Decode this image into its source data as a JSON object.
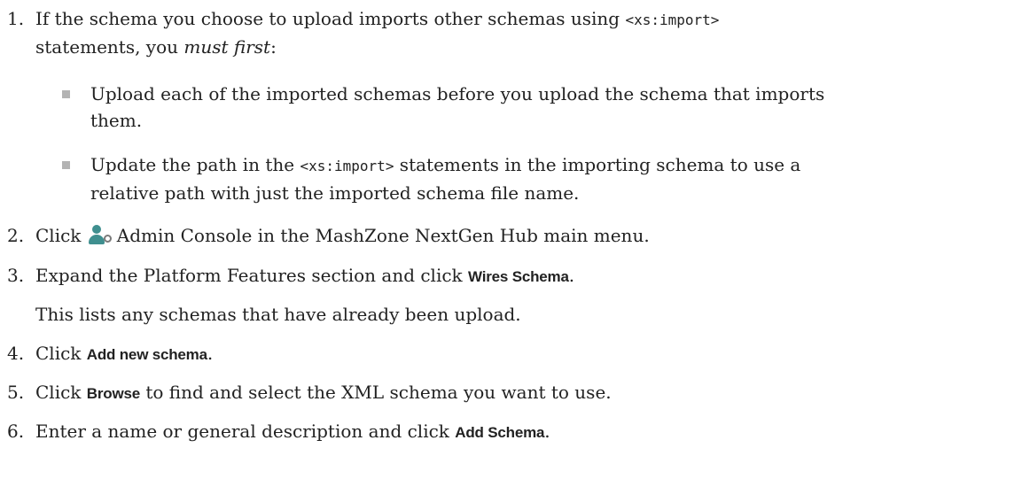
{
  "steps": [
    {
      "num": "1.",
      "before": "If the schema you choose to upload imports other schemas using ",
      "code": "<xs:import>",
      "line2_start": "statements, you ",
      "emphasis": "must first",
      "line2_end": ":",
      "bullets": [
        {
          "line1": "Upload each of the imported schemas before you upload the schema that imports",
          "line2": "them."
        },
        {
          "before": "Update the path in the ",
          "code": "<xs:import>",
          "after": " statements in the importing schema to use a",
          "line2": "relative path with just the imported schema file name."
        }
      ]
    },
    {
      "num": "2.",
      "before": "Click ",
      "icon": "admin-console-icon",
      "after": "Admin Console in the MashZone NextGen Hub main menu."
    },
    {
      "num": "3.",
      "before": "Expand the Platform Features section and click ",
      "ui": "Wires Schema",
      "after": ".",
      "note": "This lists any schemas that have already been upload."
    },
    {
      "num": "4.",
      "before": "Click ",
      "ui": "Add new schema",
      "after": "."
    },
    {
      "num": "5.",
      "before": "Click ",
      "ui": "Browse",
      "after": " to find and select the XML schema you want to use."
    },
    {
      "num": "6.",
      "before": "Enter a name or general description and click ",
      "ui": "Add Schema",
      "after": "."
    }
  ],
  "colors": {
    "text": "#222222",
    "bullet": "#b3b3b3",
    "icon_person": "#3f8f8f",
    "icon_gear": "#7a7a7a"
  }
}
